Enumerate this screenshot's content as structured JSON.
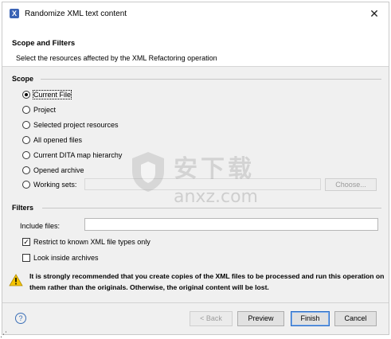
{
  "window": {
    "title": "Randomize XML text content",
    "app_icon": "oxygen-x-icon",
    "close_glyph": "✕"
  },
  "header": {
    "title": "Scope and Filters",
    "description": "Select the resources affected by the XML Refactoring operation"
  },
  "scope": {
    "label": "Scope",
    "options": [
      {
        "label": "Current File",
        "checked": true
      },
      {
        "label": "Project",
        "checked": false
      },
      {
        "label": "Selected project resources",
        "checked": false
      },
      {
        "label": "All opened files",
        "checked": false
      },
      {
        "label": "Current DITA map hierarchy",
        "checked": false
      },
      {
        "label": "Opened archive",
        "checked": false
      },
      {
        "label": "Working sets:",
        "checked": false
      }
    ],
    "choose_button": "Choose..."
  },
  "filters": {
    "label": "Filters",
    "include_label": "Include files:",
    "include_value": "",
    "restrict_label": "Restrict to known XML file types only",
    "restrict_checked": true,
    "archives_label": "Look inside archives",
    "archives_checked": false
  },
  "warning": {
    "icon": "warning-triangle-icon",
    "text": "It is strongly recommended that you create copies of the XML files to be processed and run this operation on them rather than the originals. Otherwise, the original content will be lost."
  },
  "footer": {
    "help_glyph": "?",
    "back": "< Back",
    "preview": "Preview",
    "finish": "Finish",
    "cancel": "Cancel"
  },
  "watermark": {
    "cn": "安下载",
    "latin": "anxz.com"
  },
  "colors": {
    "dialog_bg": "#f0f0f0",
    "header_bg": "#ffffff",
    "accent": "#2b6cc4",
    "warning": "#f5c400"
  }
}
